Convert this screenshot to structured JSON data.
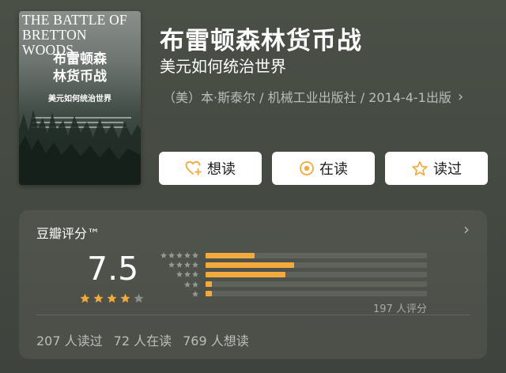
{
  "cover": {
    "english_title": "THE BATTLE OF BRETTON WOODS",
    "chinese_title": "布雷顿森林货币战",
    "subtitle": "美元如何统治世界"
  },
  "book": {
    "title": "布雷顿森林货币战",
    "subtitle": "美元如何统治世界",
    "meta": "（美）本·斯泰尔 / 机械工业出版社 / 2014-4-1出版"
  },
  "actions": {
    "want_label": "想读",
    "doing_label": "在读",
    "done_label": "读过"
  },
  "rating": {
    "header": "豆瓣评分™",
    "score": "7.5",
    "stars_filled": 4,
    "stars_total": 5,
    "distribution": [
      {
        "stars": 5,
        "fraction": 0.22
      },
      {
        "stars": 4,
        "fraction": 0.4
      },
      {
        "stars": 3,
        "fraction": 0.36
      },
      {
        "stars": 2,
        "fraction": 0.03
      },
      {
        "stars": 1,
        "fraction": 0.03
      }
    ],
    "count": "197 人评分"
  },
  "stats": {
    "read": "207 人读过",
    "reading": "72 人在读",
    "want": "769 人想读"
  },
  "colors": {
    "accent": "#f3a93b",
    "button_bg": "#ffffff",
    "bg": "#474d45"
  }
}
